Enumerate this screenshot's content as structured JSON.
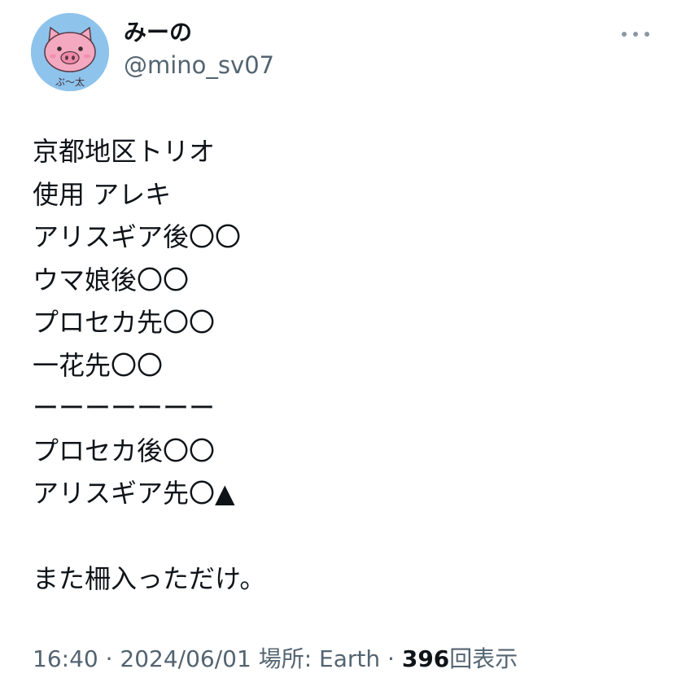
{
  "author": {
    "display_name": "みーの",
    "handle": "@mino_sv07",
    "avatar_caption": "ぶ〜太",
    "avatar_bg": "#8ec3ec",
    "avatar_icon": "pig-face-icon"
  },
  "more_icon": "more-dots-icon",
  "tweet": {
    "lines": [
      "京都地区トリオ",
      "使用 アレキ",
      "アリスギア後〇〇",
      "ウマ娘後〇〇",
      "プロセカ先〇〇",
      "一花先〇〇",
      "ーーーーーーー",
      "プロセカ後〇〇",
      "アリスギア先〇▲",
      "",
      "また柵入っただけ。"
    ]
  },
  "footer": {
    "time": "16:40",
    "sep1": " · ",
    "date": "2024/06/01",
    "location_label": " 場所: ",
    "location": "Earth",
    "sep2": " · ",
    "views_count": "396",
    "views_label": "回表示"
  },
  "colors": {
    "text": "#0f1419",
    "secondary_text": "#536471",
    "background": "#ffffff"
  }
}
